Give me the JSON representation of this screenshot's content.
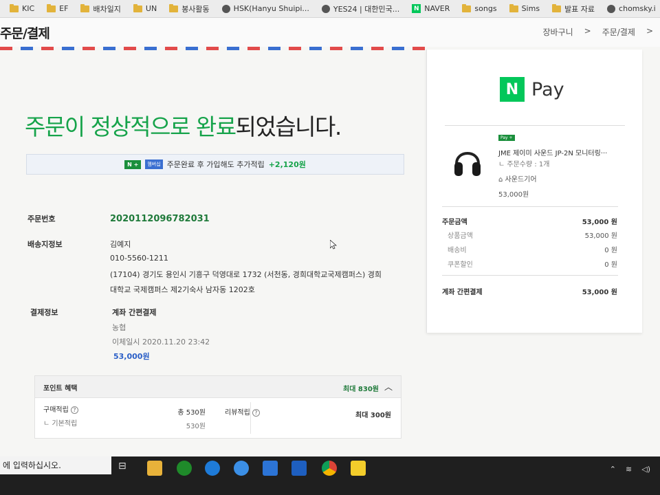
{
  "bookmarks": [
    {
      "label": "KIC",
      "icon": "folder-icon"
    },
    {
      "label": "EF",
      "icon": "folder-icon"
    },
    {
      "label": "배차일지",
      "icon": "folder-icon"
    },
    {
      "label": "UN",
      "icon": "folder-icon"
    },
    {
      "label": "봉사활동",
      "icon": "folder-icon"
    },
    {
      "label": "HSK(Hanyu Shuipi...",
      "icon": "globe-icon"
    },
    {
      "label": "YES24 | 대한민국...",
      "icon": "globe-icon"
    },
    {
      "label": "NAVER",
      "icon": "naver-icon"
    },
    {
      "label": "songs",
      "icon": "folder-icon"
    },
    {
      "label": "Sims",
      "icon": "folder-icon"
    },
    {
      "label": "발표 자료",
      "icon": "folder-icon"
    },
    {
      "label": "chomsky.i",
      "icon": "globe-icon"
    }
  ],
  "header": {
    "title": "주문/결제",
    "breadcrumbs": [
      "장바구니",
      ">",
      "주문/결제",
      ">"
    ]
  },
  "headline": {
    "green": "주문이 정상적으로 완료",
    "rest": "되었습니다."
  },
  "promo": {
    "badge": "N +",
    "member": "멤버십",
    "text": "주문완료 후 가입해도 추가적립",
    "amount": "+2,120원"
  },
  "order": {
    "order_no_label": "주문번호",
    "order_no": "2020112096782031",
    "shipping_label": "배송지정보",
    "name": "김예지",
    "phone": "010-5560-1211",
    "address1": "(17104) 경기도 용인시 기흥구 덕영대로 1732 (서천동, 경희대학교국제캠퍼스) 경희",
    "address2": "대학교 국제캠퍼스 제2기숙사 남자동 1202호",
    "payment_label": "결제정보",
    "payment_method": "계좌 간편결제",
    "bank": "농협",
    "paid_at": "이체일시 2020.11.20 23:42",
    "paid_amount": "53,000원"
  },
  "points": {
    "title": "포인트 혜택",
    "max": "최대 830원",
    "purchase_label": "구매적립",
    "purchase_total": "총 530원",
    "basic_label": "ㄴ 기본적립",
    "basic_value": "530원",
    "review_label": "리뷰적립",
    "review_value": "최대 300원"
  },
  "panel": {
    "logo_n": "N",
    "logo_text": "Pay",
    "badge": "Pay +",
    "product_name": "JME 제이미 사운드 JP-2N 모니터링···",
    "quantity": "ㄴ 주문수량 : 1개",
    "store": "사운드기어",
    "product_price": "53,000원",
    "order_amount_label": "주문금액",
    "order_amount": "53,000 원",
    "goods_label": "상품금액",
    "goods_amount": "53,000 원",
    "shipping_label": "배송비",
    "shipping_amount": "0 원",
    "coupon_label": "쿠폰할인",
    "coupon_amount": "0 원",
    "pay_label": "계좌 간편결제",
    "pay_amount": "53,000 원"
  },
  "taskbar": {
    "search_text": "에 입력하십시오."
  }
}
